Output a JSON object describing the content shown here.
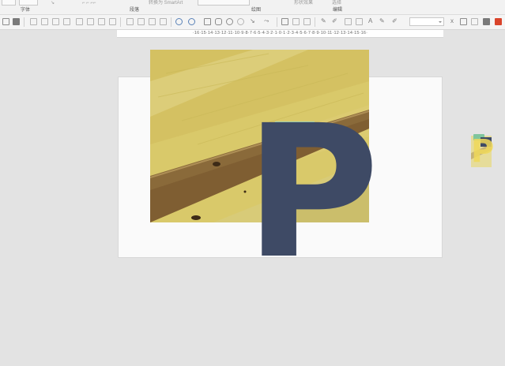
{
  "ribbon": {
    "smartart_label": "转换为 SmartArt",
    "shape_effect_label": "形状效果",
    "select_label": "选择",
    "groups": {
      "font": "字体",
      "paragraph": "段落",
      "drawing": "绘图",
      "editing": "编辑"
    }
  },
  "toolbar": {
    "font_size_value": "",
    "text_glyph": "A",
    "x_glyph": "x"
  },
  "ruler": {
    "text": "·16·15·14·13·12·11·10·9·8·7·6·5·4·3·2·1·0·1·2·3·4·5·6·7·8·9·10·11·12·13·14·15·16·"
  },
  "slide": {
    "big_letter": "P",
    "letter_color": "#3e4a65"
  },
  "thumbnail": {
    "letter": "P"
  }
}
